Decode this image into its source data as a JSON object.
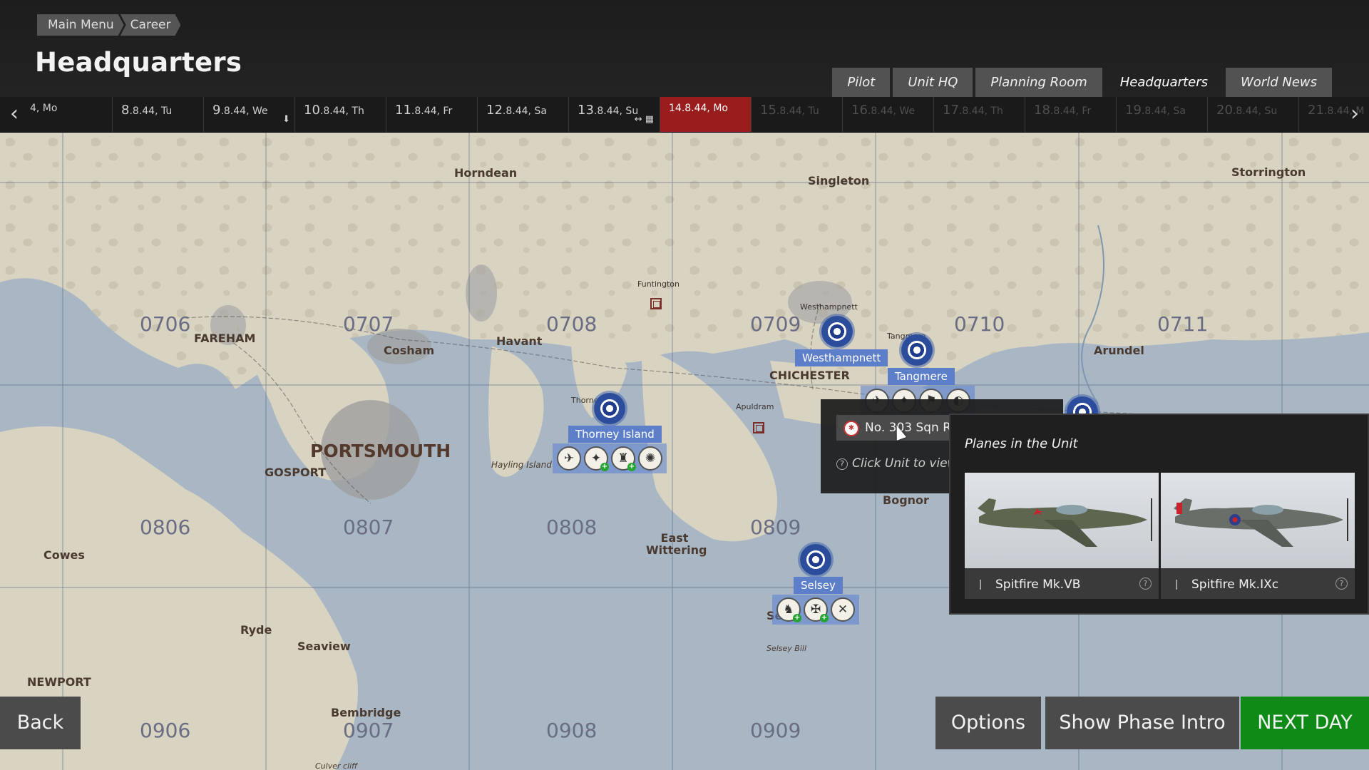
{
  "breadcrumb": [
    "Main Menu",
    "Career"
  ],
  "page_title": "Headquarters",
  "tabs": [
    {
      "label": "Pilot",
      "active": false
    },
    {
      "label": "Unit HQ",
      "active": false
    },
    {
      "label": "Planning Room",
      "active": false
    },
    {
      "label": "Headquarters",
      "active": true
    },
    {
      "label": "World News",
      "active": false
    }
  ],
  "timeline": {
    "days": [
      {
        "num": "",
        "rest": "4, Mo",
        "state": "past"
      },
      {
        "num": "8",
        "rest": ".8.44, Tu",
        "state": "past"
      },
      {
        "num": "9",
        "rest": ".8.44, We",
        "state": "past"
      },
      {
        "num": "10",
        "rest": ".8.44, Th",
        "state": "past"
      },
      {
        "num": "11",
        "rest": ".8.44, Fr",
        "state": "past"
      },
      {
        "num": "12",
        "rest": ".8.44, Sa",
        "state": "past"
      },
      {
        "num": "13",
        "rest": ".8.44, Su",
        "state": "past"
      },
      {
        "num": "",
        "rest": "14.8.44, Mo",
        "state": "today"
      },
      {
        "num": "15",
        "rest": ".8.44, Tu",
        "state": "future"
      },
      {
        "num": "16",
        "rest": ".8.44, We",
        "state": "future"
      },
      {
        "num": "17",
        "rest": ".8.44, Th",
        "state": "future"
      },
      {
        "num": "18",
        "rest": ".8.44, Fr",
        "state": "future"
      },
      {
        "num": "19",
        "rest": ".8.44, Sa",
        "state": "future"
      },
      {
        "num": "20",
        "rest": ".8.44, Su",
        "state": "future"
      },
      {
        "num": "21",
        "rest": ".8.44, M",
        "state": "future"
      }
    ]
  },
  "map": {
    "places": [
      {
        "name": "Horndean",
        "style": ""
      },
      {
        "name": "Singleton",
        "style": ""
      },
      {
        "name": "Storrington",
        "style": ""
      },
      {
        "name": "Funtington",
        "style": "small"
      },
      {
        "name": "Westhampnett",
        "style": "small"
      },
      {
        "name": "FAREHAM",
        "style": ""
      },
      {
        "name": "Cosham",
        "style": ""
      },
      {
        "name": "Havant",
        "style": ""
      },
      {
        "name": "CHICHESTER",
        "style": ""
      },
      {
        "name": "Arundel",
        "style": ""
      },
      {
        "name": "Apuldram",
        "style": "small"
      },
      {
        "name": "PORTSMOUTH",
        "style": "big"
      },
      {
        "name": "GOSPORT",
        "style": ""
      },
      {
        "name": "Hayling Island",
        "style": "italic"
      },
      {
        "name": "Bognor",
        "style": ""
      },
      {
        "name": "East Wittering",
        "style": ""
      },
      {
        "name": "Cowes",
        "style": ""
      },
      {
        "name": "Ryde",
        "style": ""
      },
      {
        "name": "Seaview",
        "style": ""
      },
      {
        "name": "NEWPORT",
        "style": ""
      },
      {
        "name": "Bembridge",
        "style": ""
      },
      {
        "name": "Selsey Bill",
        "style": "italic"
      },
      {
        "name": "Culver cliff",
        "style": "italic"
      },
      {
        "name": "Thorney",
        "style": "small"
      },
      {
        "name": "Tangmere",
        "style": "small"
      },
      {
        "name": "Se",
        "style": ""
      }
    ],
    "grid_codes": [
      "0706",
      "0707",
      "0708",
      "0709",
      "0710",
      "0711",
      "0806",
      "0807",
      "0808",
      "0809",
      "0906",
      "0907",
      "0908",
      "0909"
    ],
    "airfields": [
      {
        "name": "Westhampnett",
        "badges": 0
      },
      {
        "name": "Tangmere",
        "badges": 0
      },
      {
        "name": "Thorney Island",
        "badges": 4
      },
      {
        "name": "Selsey",
        "badges": 3
      }
    ]
  },
  "unit_tooltip": {
    "name": "No. 303 Sqn R",
    "help": "Click Unit to view"
  },
  "planes_popup": {
    "title": "Planes in the Unit",
    "planes": [
      {
        "name": "Spitfire Mk.VB",
        "marking_color": "#c8222b"
      },
      {
        "name": "Spitfire Mk.IXc",
        "marking_color": "#2d3f8c"
      }
    ]
  },
  "buttons": {
    "back": "Back",
    "options": "Options",
    "phase_intro": "Show Phase Intro",
    "next_day": "NEXT DAY"
  },
  "colors": {
    "accent_today": "#9a1d1d",
    "next_day": "#0f8a16",
    "airfield_label": "#5d7fc9",
    "sea": "#a9b7c4",
    "land": "#d9d3c1"
  }
}
